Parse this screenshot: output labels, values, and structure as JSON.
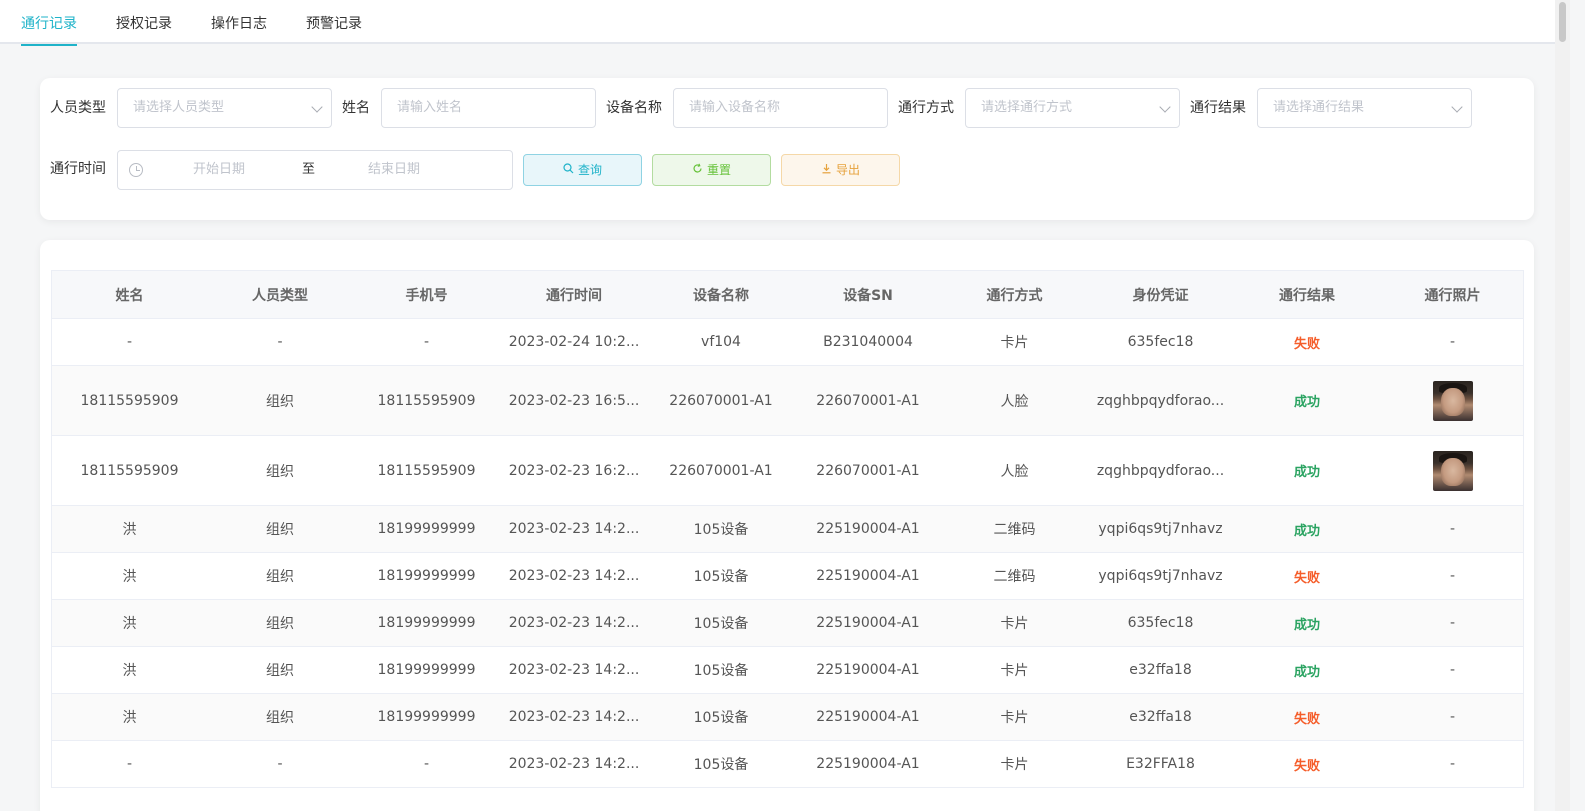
{
  "tabs": [
    {
      "label": "通行记录",
      "active": true
    },
    {
      "label": "授权记录",
      "active": false
    },
    {
      "label": "操作日志",
      "active": false
    },
    {
      "label": "预警记录",
      "active": false
    }
  ],
  "filters": {
    "person_type": {
      "label": "人员类型",
      "placeholder": "请选择人员类型"
    },
    "name": {
      "label": "姓名",
      "placeholder": "请输入姓名"
    },
    "device_name": {
      "label": "设备名称",
      "placeholder": "请输入设备名称"
    },
    "pass_method": {
      "label": "通行方式",
      "placeholder": "请选择通行方式"
    },
    "pass_result": {
      "label": "通行结果",
      "placeholder": "请选择通行结果"
    },
    "pass_time": {
      "label": "通行时间",
      "start_placeholder": "开始日期",
      "separator": "至",
      "end_placeholder": "结束日期"
    }
  },
  "buttons": {
    "query": "查询",
    "reset": "重置",
    "export": "导出"
  },
  "table": {
    "headers": [
      "姓名",
      "人员类型",
      "手机号",
      "通行时间",
      "设备名称",
      "设备SN",
      "通行方式",
      "身份凭证",
      "通行结果",
      "通行照片"
    ],
    "rows": [
      {
        "name": "-",
        "type": "-",
        "phone": "-",
        "time": "2023-02-24 10:2...",
        "device": "vf104",
        "sn": "B231040004",
        "method": "卡片",
        "credential": "635fec18",
        "result": "失败",
        "ok": false,
        "photo": "-"
      },
      {
        "name": "18115595909",
        "type": "组织",
        "phone": "18115595909",
        "time": "2023-02-23 16:5...",
        "device": "226070001-A1",
        "sn": "226070001-A1",
        "method": "人脸",
        "credential": "zqghbpqydforao...",
        "result": "成功",
        "ok": true,
        "photo": "face-photo"
      },
      {
        "name": "18115595909",
        "type": "组织",
        "phone": "18115595909",
        "time": "2023-02-23 16:2...",
        "device": "226070001-A1",
        "sn": "226070001-A1",
        "method": "人脸",
        "credential": "zqghbpqydforao...",
        "result": "成功",
        "ok": true,
        "photo": "face-photo"
      },
      {
        "name": "洪",
        "type": "组织",
        "phone": "18199999999",
        "time": "2023-02-23 14:2...",
        "device": "105设备",
        "sn": "225190004-A1",
        "method": "二维码",
        "credential": "yqpi6qs9tj7nhavz",
        "result": "成功",
        "ok": true,
        "photo": "-"
      },
      {
        "name": "洪",
        "type": "组织",
        "phone": "18199999999",
        "time": "2023-02-23 14:2...",
        "device": "105设备",
        "sn": "225190004-A1",
        "method": "二维码",
        "credential": "yqpi6qs9tj7nhavz",
        "result": "失败",
        "ok": false,
        "photo": "-"
      },
      {
        "name": "洪",
        "type": "组织",
        "phone": "18199999999",
        "time": "2023-02-23 14:2...",
        "device": "105设备",
        "sn": "225190004-A1",
        "method": "卡片",
        "credential": "635fec18",
        "result": "成功",
        "ok": true,
        "photo": "-"
      },
      {
        "name": "洪",
        "type": "组织",
        "phone": "18199999999",
        "time": "2023-02-23 14:2...",
        "device": "105设备",
        "sn": "225190004-A1",
        "method": "卡片",
        "credential": "e32ffa18",
        "result": "成功",
        "ok": true,
        "photo": "-"
      },
      {
        "name": "洪",
        "type": "组织",
        "phone": "18199999999",
        "time": "2023-02-23 14:2...",
        "device": "105设备",
        "sn": "225190004-A1",
        "method": "卡片",
        "credential": "e32ffa18",
        "result": "失败",
        "ok": false,
        "photo": "-"
      },
      {
        "name": "-",
        "type": "-",
        "phone": "-",
        "time": "2023-02-23 14:2...",
        "device": "105设备",
        "sn": "225190004-A1",
        "method": "卡片",
        "credential": "E32FFA18",
        "result": "失败",
        "ok": false,
        "photo": "-"
      }
    ]
  },
  "colors": {
    "accent": "#1fb3c9",
    "success": "#2aa361",
    "failure": "#f55d2a",
    "reset_btn": "#67c23a",
    "export_btn": "#e6a23c"
  },
  "icons": {
    "query": "search-icon",
    "reset": "refresh-icon",
    "export": "download-icon",
    "date": "clock-icon",
    "select": "chevron-down-icon"
  }
}
